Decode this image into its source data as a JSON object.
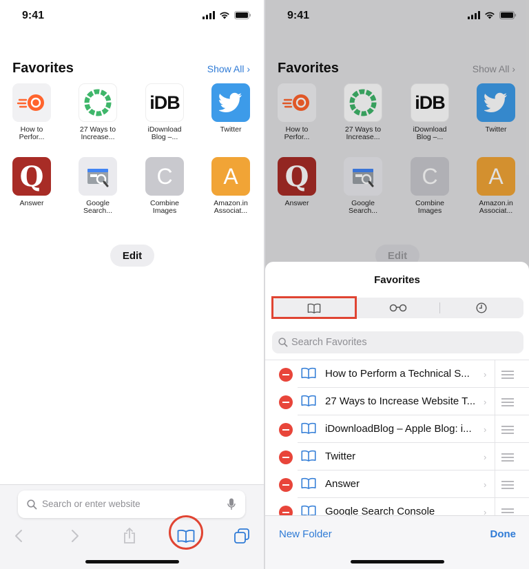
{
  "status_bar": {
    "time": "9:41"
  },
  "favorites": {
    "title": "Favorites",
    "show_all": "Show All",
    "show_all_chevron": "›",
    "items": [
      {
        "line1": "How to",
        "line2": "Perfor...",
        "icon": "semrush-icon",
        "color": "#f1f1f3"
      },
      {
        "line1": "27 Ways to",
        "line2": "Increase...",
        "icon": "ring-icon",
        "color": "#ffffff"
      },
      {
        "line1": "iDownload",
        "line2": "Blog –...",
        "icon": "idb-icon",
        "icon_text": "iDB",
        "color": "#ffffff"
      },
      {
        "line1": "Twitter",
        "line2": "",
        "icon": "twitter-bird-icon",
        "color": "#3d9be9"
      },
      {
        "line1": "Answer",
        "line2": "",
        "icon": "quora-icon",
        "icon_text": "Q",
        "color": "#a82c26"
      },
      {
        "line1": "Google",
        "line2": "Search...",
        "icon": "search-console-icon",
        "color": "#eaeaee"
      },
      {
        "line1": "Combine",
        "line2": "Images",
        "icon": "letter-c-icon",
        "icon_text": "C",
        "color": "#c9c9ce"
      },
      {
        "line1": "Amazon.in",
        "line2": "Associat...",
        "icon": "letter-a-icon",
        "icon_text": "A",
        "color": "#f1a436"
      }
    ],
    "edit_label": "Edit"
  },
  "address_bar": {
    "placeholder": "Search or enter website"
  },
  "sheet": {
    "title": "Favorites",
    "search_placeholder": "Search Favorites",
    "rows": [
      "How to Perform a Technical S...",
      "27 Ways to Increase Website T...",
      "iDownloadBlog – Apple Blog: i...",
      "Twitter",
      "Answer",
      "Google Search Console"
    ],
    "chevron": "›",
    "new_folder": "New Folder",
    "done": "Done"
  },
  "colors": {
    "accent": "#2f7bd6",
    "highlight": "#e04432",
    "delete": "#e8453a"
  }
}
